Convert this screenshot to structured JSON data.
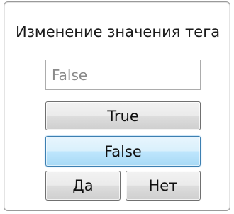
{
  "dialog": {
    "title": "Изменение значения тега"
  },
  "value_field": {
    "value": "False",
    "placeholder": ""
  },
  "buttons": {
    "true_label": "True",
    "false_label": "False",
    "yes_label": "Да",
    "no_label": "Нет"
  },
  "focused_button": "False",
  "colors": {
    "focus_border": "#3c7fb1",
    "focus_fill": "#bee6fd",
    "dialog_border": "#9a9a9a"
  }
}
